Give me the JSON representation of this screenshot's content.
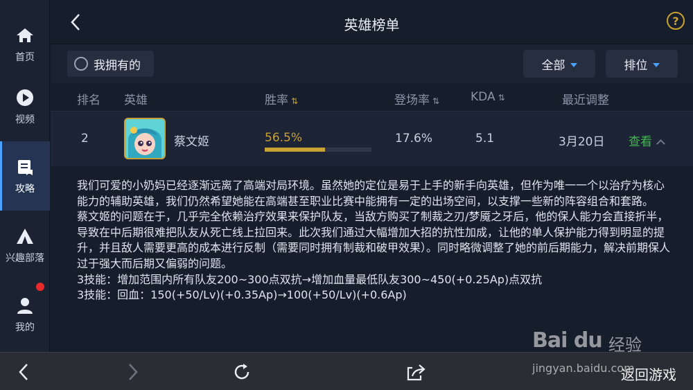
{
  "sidebar": {
    "items": [
      {
        "label": "首页",
        "icon": "home-icon"
      },
      {
        "label": "视频",
        "icon": "play-icon"
      },
      {
        "label": "攻略",
        "icon": "guide-icon",
        "active": true
      },
      {
        "label": "兴趣部落",
        "icon": "tent-icon"
      },
      {
        "label": "我的",
        "icon": "user-icon",
        "badge": "red-dot"
      }
    ]
  },
  "header": {
    "title": "英雄榜单",
    "back_icon": "chevron-left-icon",
    "help_label": "?"
  },
  "filters": {
    "own_label": "我拥有的",
    "all_label": "全部",
    "rank_label": "排位"
  },
  "columns": {
    "rank": "排名",
    "hero": "英雄",
    "winrate": "胜率",
    "pickrate": "登场率",
    "kda": "KDA",
    "recent": "最近调整"
  },
  "hero": {
    "rank": "2",
    "name": "蔡文姬",
    "winrate": "56.5%",
    "winrate_fraction": 0.565,
    "pickrate": "17.6%",
    "kda": "5.1",
    "recent_date": "3月20日",
    "view_label": "查看"
  },
  "description": {
    "lines": [
      "我们可爱的小奶妈已经逐渐远离了高端对局环境。虽然她的定位是易于上手的新手向英雄，但作为唯一一个以治疗为核心能力的辅助英雄，我们仍然希望她能在高端甚至职业比赛中能拥有一定的出场空间，以支撑一些新的阵容组合和套路。",
      "蔡文姬的问题在于，几乎完全依赖治疗效果来保护队友，当敌方购买了制裁之刃/梦魇之牙后，他的保人能力会直接折半，导致在中后期很难把队友从死亡线上拉回来。此次我们通过大幅增加大招的抗性加成，让他的单人保护能力得到明显的提升，并且敌人需要更高的成本进行反制（需要同时拥有制裁和破甲效果）。同时略微调整了她的前后期能力，解决前期保人过于强大而后期又偏弱的问题。",
      "3技能：增加范围内所有队友200~300点双抗→增加血量最低队友300~450(+0.25Ap)点双抗",
      "3技能：回血：150(+50/Lv)(+0.35Ap)→100(+50/Lv)(+0.6Ap)"
    ]
  },
  "bottombar": {
    "return_label": "返回游戏"
  },
  "watermark": {
    "logo": "Bai du",
    "cn": "经验",
    "url": "jingyan.baidu.com"
  },
  "colors": {
    "accent_gold": "#c9a233",
    "link_green": "#3fb84b",
    "active_blue": "#4aa3ff"
  }
}
